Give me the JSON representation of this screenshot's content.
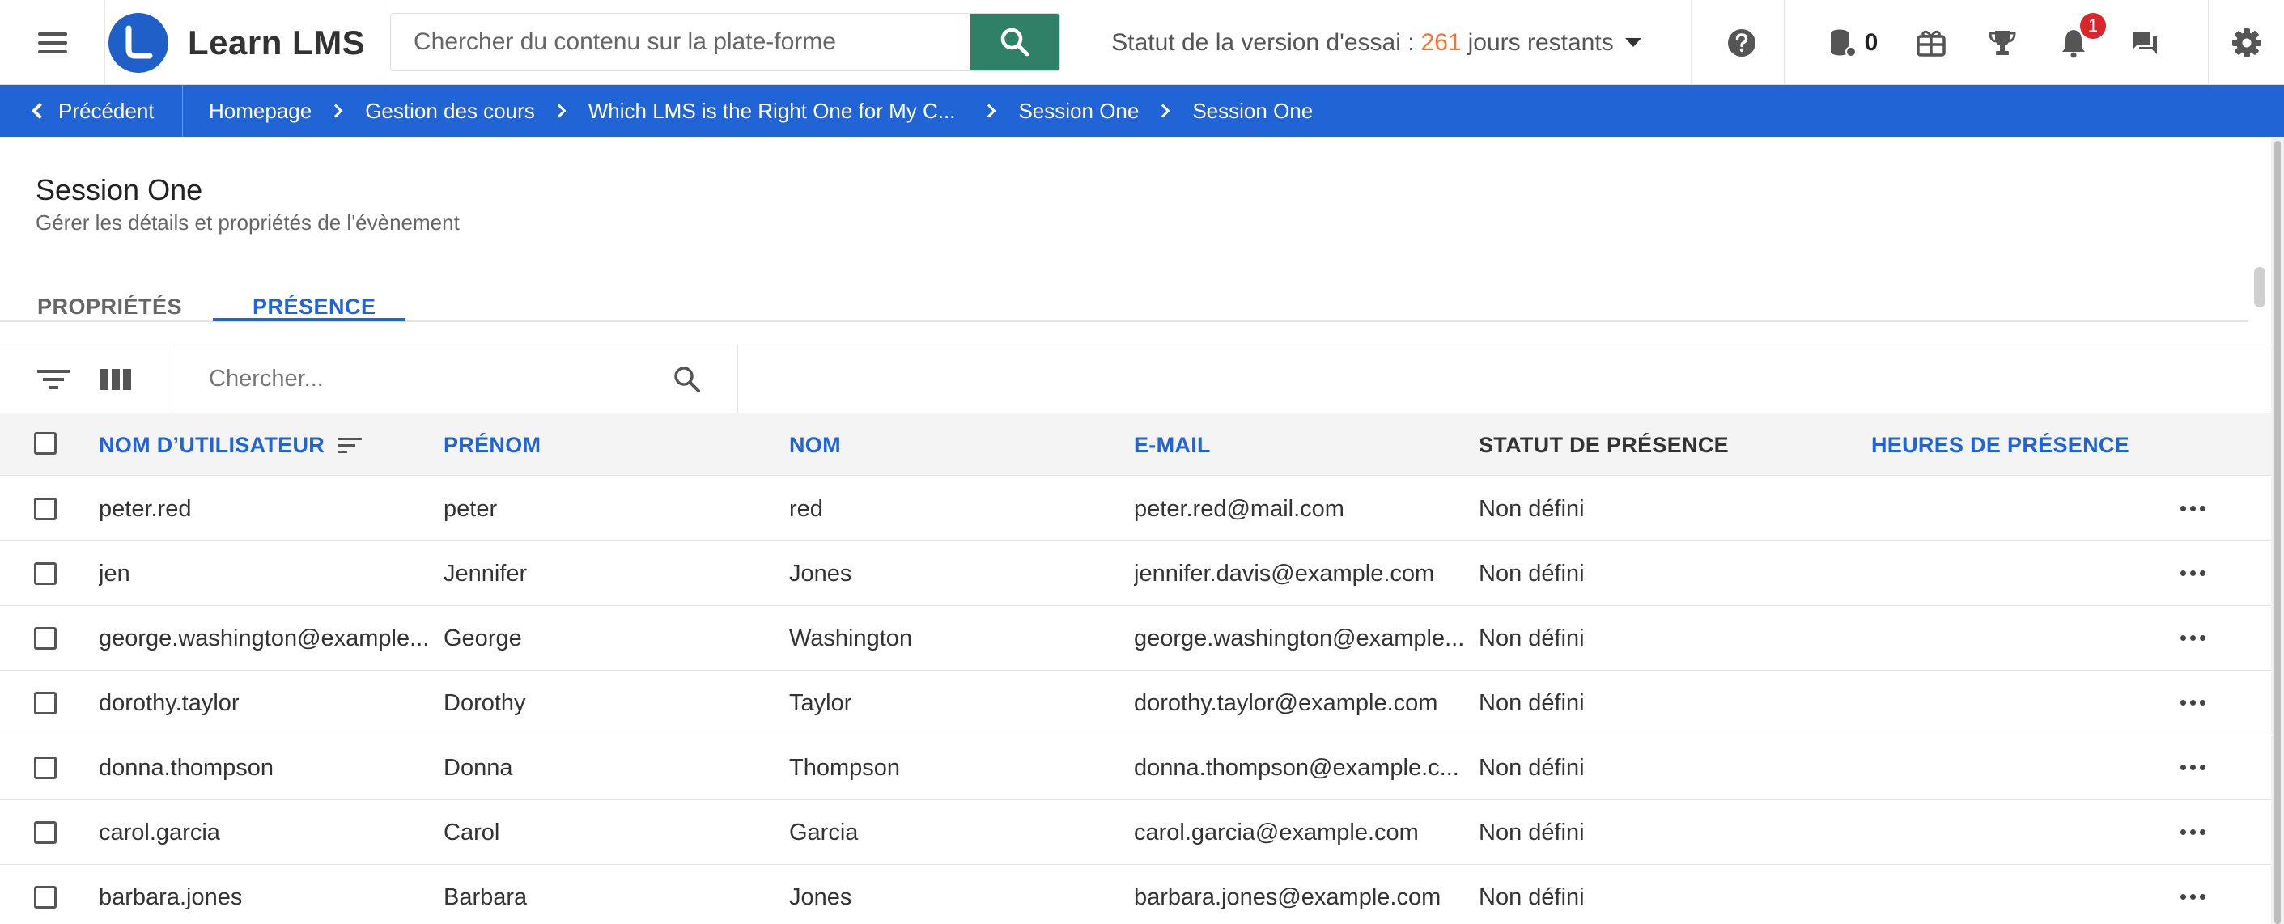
{
  "app": {
    "name": "Learn LMS"
  },
  "search": {
    "placeholder": "Chercher du contenu sur la plate-forme"
  },
  "trial": {
    "prefix": "Statut de la version d'essai :",
    "days": "261",
    "suffix": "jours restants"
  },
  "header_icons": {
    "coins": "0",
    "notifications": "1"
  },
  "breadcrumb": {
    "back": "Précédent",
    "items": [
      "Homepage",
      "Gestion des cours",
      "Which LMS is the Right One for My C...",
      "Session One",
      "Session One"
    ]
  },
  "page": {
    "title": "Session One",
    "subtitle": "Gérer les détails et propriétés de l'évènement"
  },
  "tabs": [
    {
      "label": "PROPRIÉTÉS"
    },
    {
      "label": "PRÉSENCE"
    }
  ],
  "table_search": {
    "placeholder": "Chercher..."
  },
  "table": {
    "columns": [
      "NOM D’UTILISATEUR",
      "PRÉNOM",
      "NOM",
      "E-MAIL",
      "STATUT DE PRÉSENCE",
      "HEURES DE PRÉSENCE"
    ],
    "rows": [
      [
        "peter.red",
        "peter",
        "red",
        "peter.red@mail.com",
        "Non défini"
      ],
      [
        "jen",
        "Jennifer",
        "Jones",
        "jennifer.davis@example.com",
        "Non défini"
      ],
      [
        "george.washington@example...",
        "George",
        "Washington",
        "george.washington@example...",
        "Non défini"
      ],
      [
        "dorothy.taylor",
        "Dorothy",
        "Taylor",
        "dorothy.taylor@example.com",
        "Non défini"
      ],
      [
        "donna.thompson",
        "Donna",
        "Thompson",
        "donna.thompson@example.c...",
        "Non défini"
      ],
      [
        "carol.garcia",
        "Carol",
        "Garcia",
        "carol.garcia@example.com",
        "Non défini"
      ],
      [
        "barbara.jones",
        "Barbara",
        "Jones",
        "barbara.jones@example.com",
        "Non défini"
      ]
    ]
  },
  "colors": {
    "primary": "#2164d6",
    "search_button": "#2f8066",
    "trial_days": "#e8773b",
    "badge": "#d9262c"
  },
  "icons": [
    "menu-icon",
    "logo-icon",
    "search-icon",
    "caret-down-icon",
    "help-icon",
    "coins-icon",
    "gift-icon",
    "trophy-icon",
    "bell-icon",
    "chat-icon",
    "gear-icon",
    "chevron-left-icon",
    "chevron-right-icon",
    "filter-icon",
    "columns-icon",
    "sort-icon",
    "more-icon"
  ]
}
